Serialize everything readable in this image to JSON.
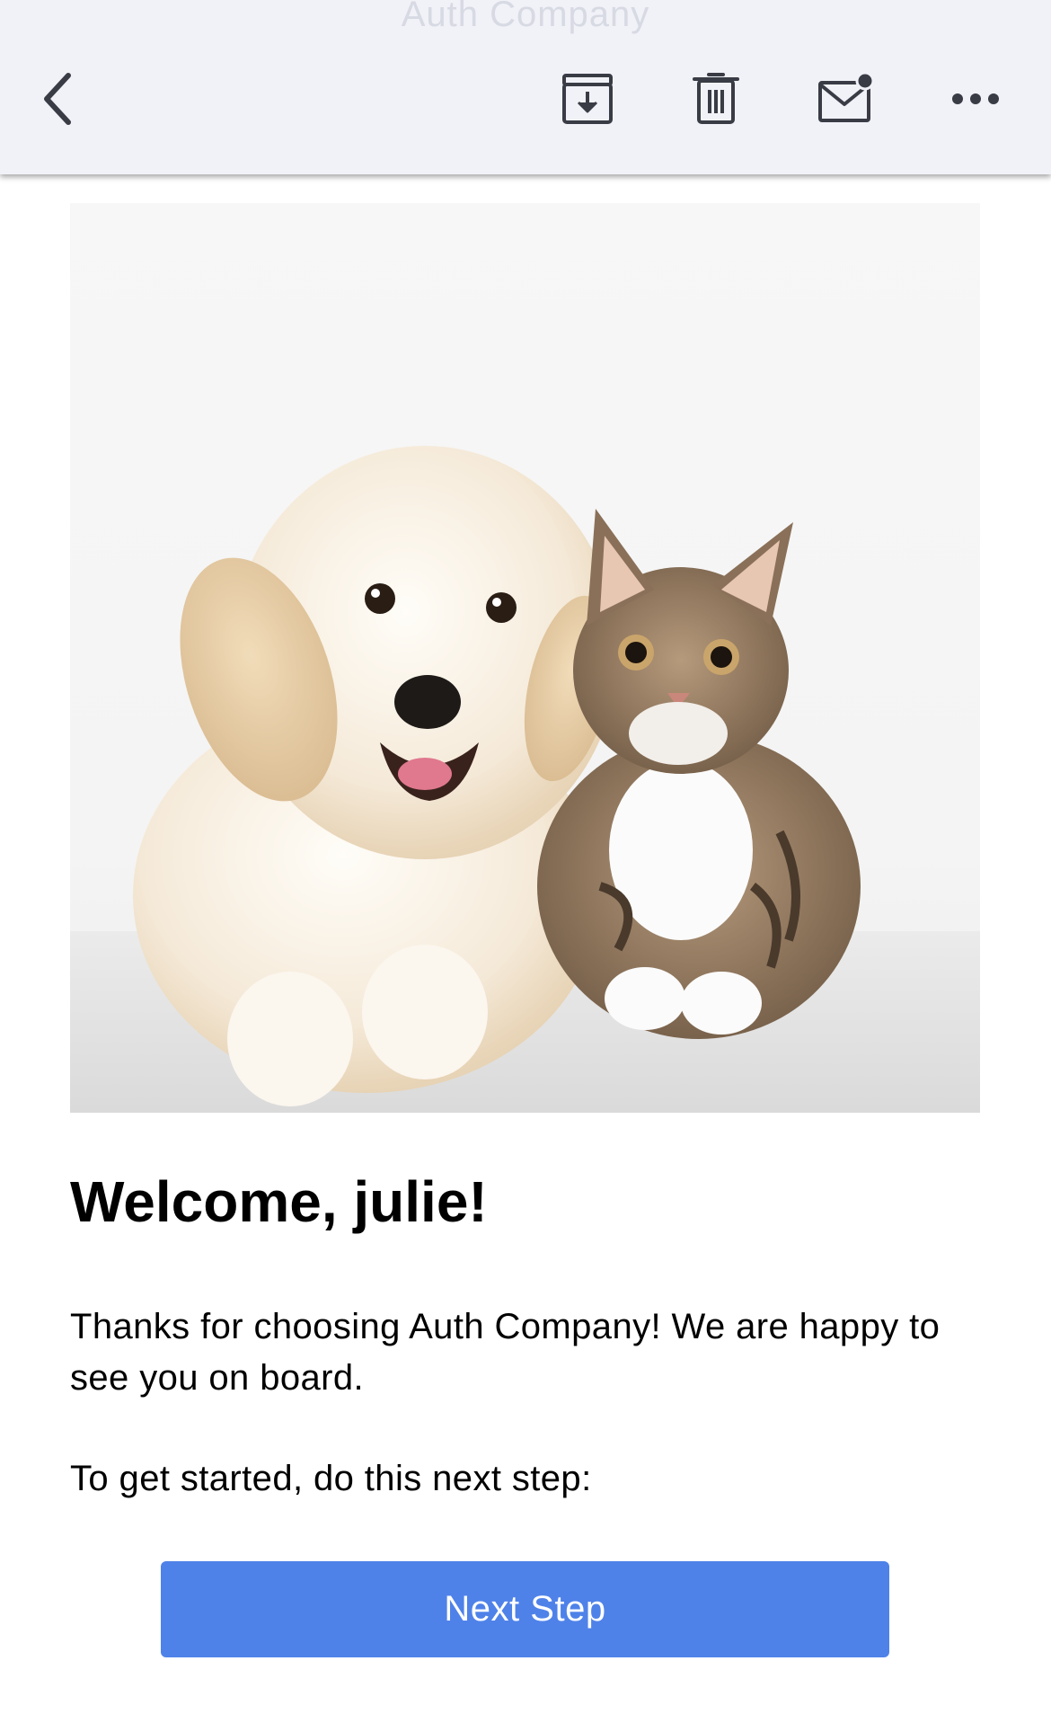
{
  "toolbar": {
    "faded_title": "Auth Company",
    "icons": {
      "back": "chevron-left-icon",
      "archive": "archive-icon",
      "delete": "trash-icon",
      "mark_unread": "mail-unread-icon",
      "more": "more-horizontal-icon"
    },
    "background": "#f1f2f8",
    "icon_color": "#3a3c45"
  },
  "email": {
    "hero_image": "puppy-and-kitten-photo",
    "headline": "Welcome, julie!",
    "paragraph_1": "Thanks for choosing Auth Company! We are happy to see you on board.",
    "paragraph_2": "To get started, do this next step:",
    "cta_label": "Next Step",
    "cta_color": "#4f82e9"
  }
}
